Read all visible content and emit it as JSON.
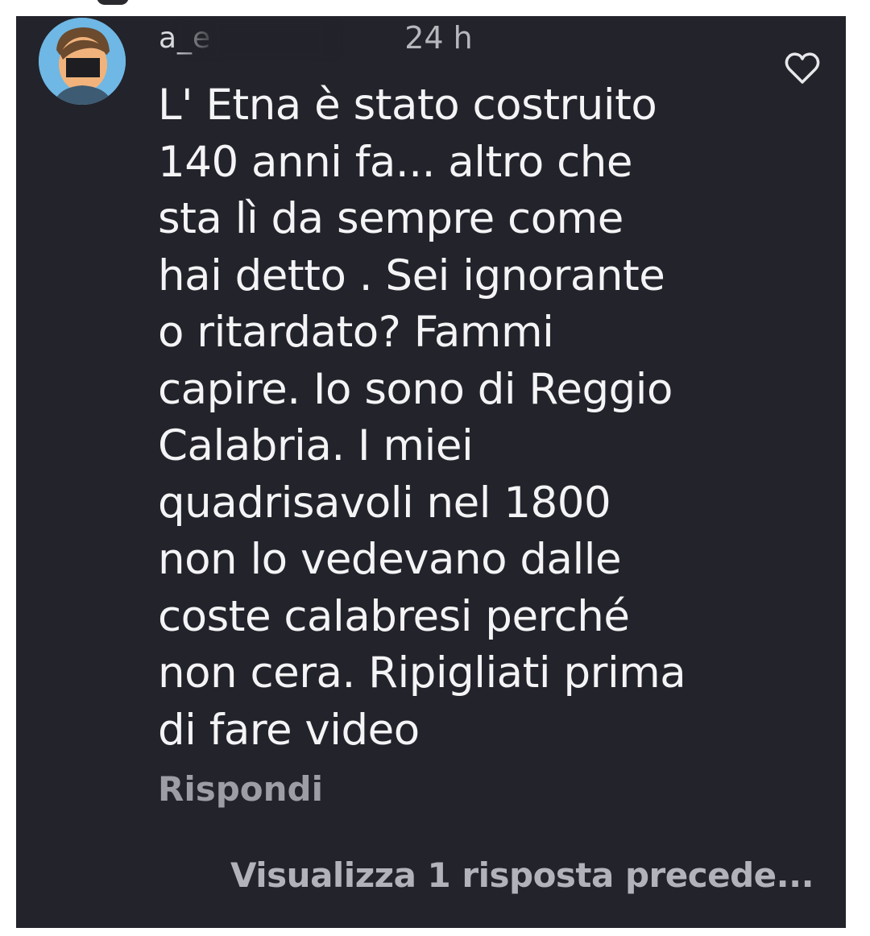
{
  "comment": {
    "username": "a_e",
    "timestamp": "24 h",
    "text": "L' Etna è stato costruito\n140 anni fa... altro che\nsta lì da sempre come\nhai detto . Sei ignorante\no ritardato? Fammi\ncapire. Io sono di Reggio\nCalabria. I miei\nquadrisavoli nel 1800\nnon lo vedevano dalle\ncoste  calabresi perché\nnon cera. Ripigliati prima\ndi fare video",
    "reply_label": "Rispondi",
    "like_icon": "heart-outline-icon"
  },
  "thread": {
    "view_replies_label": "Visualizza 1 risposta precede..."
  },
  "colors": {
    "background": "#23232b",
    "text": "#f4f4f6",
    "muted": "#9d9da6",
    "avatar_bg": "#6fb7e4"
  }
}
